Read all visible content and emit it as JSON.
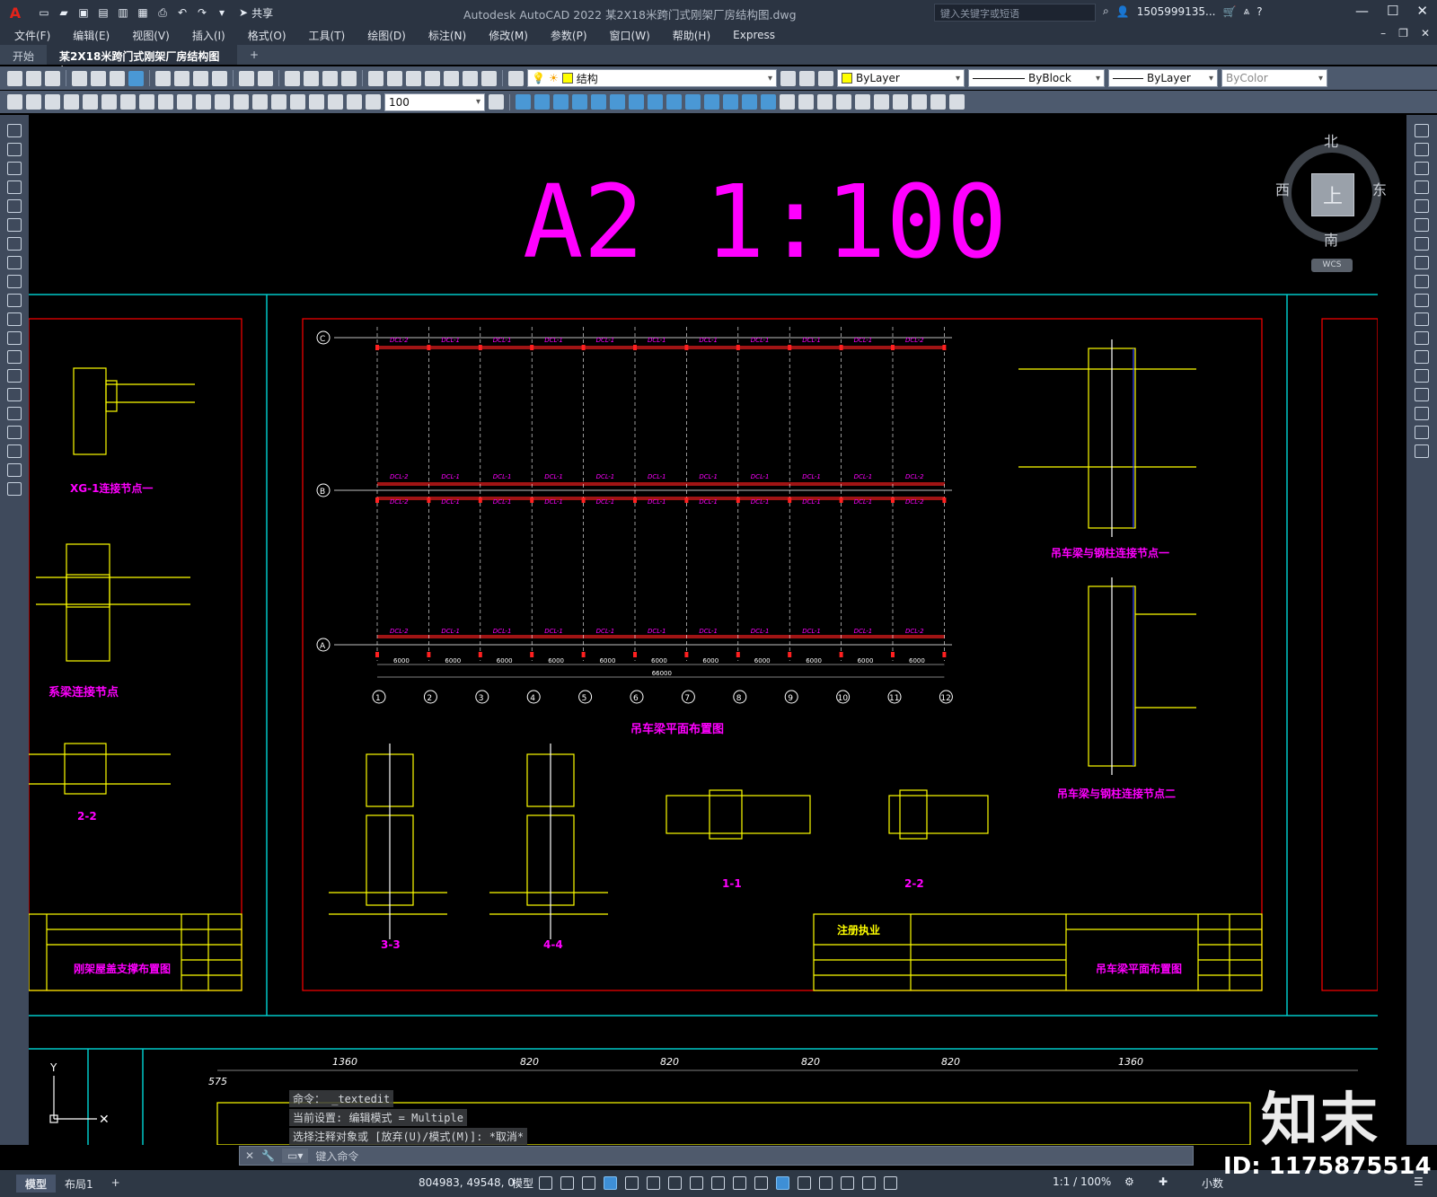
{
  "titlebar": {
    "logo": "A",
    "share": "共享",
    "app_title": "Autodesk AutoCAD 2022    某2X18米跨门式刚架厂房结构图.dwg",
    "search_placeholder": "键入关键字或短语",
    "user": "1505999135...",
    "min": "—",
    "max": "☐",
    "close": "✕"
  },
  "menubar": {
    "items": [
      "文件(F)",
      "编辑(E)",
      "视图(V)",
      "插入(I)",
      "格式(O)",
      "工具(T)",
      "绘图(D)",
      "标注(N)",
      "修改(M)",
      "参数(P)",
      "窗口(W)",
      "帮助(H)",
      "Express"
    ]
  },
  "tabs": {
    "start": "开始",
    "doc": "某2X18米跨门式刚架厂房结构图*",
    "close": "✕",
    "add": "+"
  },
  "toolbar1": {
    "layer": "结构",
    "color": "ByLayer",
    "linetype": "ByBlock",
    "lineweight": "ByLayer",
    "plotstyle": "ByColor"
  },
  "toolbar2": {
    "scale": "100"
  },
  "drawing": {
    "sheet_title": "A2 1:100",
    "main_caption": "吊车梁平面布置图",
    "detail1": "XG-1连接节点一",
    "detail2": "系梁连接节点",
    "section_22_left": "2-2",
    "detail_right1": "吊车梁与钢柱连接节点一",
    "detail_right2": "吊车梁与钢柱连接节点二",
    "sec_33": "3-3",
    "sec_44": "4-4",
    "sec_11": "1-1",
    "sec_22": "2-2",
    "tb_left_title": "刚架屋盖支撑布置图",
    "tb_right_title": "吊车梁平面布置图",
    "tb_reg": "注册执业",
    "axes": [
      "1",
      "2",
      "3",
      "4",
      "5",
      "6",
      "7",
      "8",
      "9",
      "10",
      "11",
      "12"
    ],
    "spans": [
      "6000",
      "6000",
      "6000",
      "6000",
      "6000",
      "6000",
      "6000",
      "6000",
      "6000",
      "6000",
      "6000"
    ],
    "total": "66000",
    "row_labels": [
      "C",
      "B",
      "A"
    ],
    "beams_top": [
      "DCL-2",
      "DCL-1",
      "DCL-1",
      "DCL-1",
      "DCL-1",
      "DCL-1",
      "DCL-1",
      "DCL-1",
      "DCL-1",
      "DCL-1",
      "DCL-2"
    ],
    "bottom_dims": [
      "1360",
      "820",
      "820",
      "820",
      "820",
      "1360"
    ],
    "dim_575": "575",
    "ucs_y": "Y"
  },
  "viewcube": {
    "north": "北",
    "south": "南",
    "east": "东",
    "west": "西",
    "top": "上",
    "wcs": "WCS"
  },
  "command": {
    "line1": "命令： _textedit",
    "line2": "当前设置: 编辑模式 = Multiple",
    "line3": "选择注释对象或 [放弃(U)/模式(M)]: *取消*",
    "input_placeholder": "键入命令"
  },
  "statusbar": {
    "tab_model": "模型",
    "tab_layout": "布局1",
    "add": "+",
    "coords": "804983, 49548, 0",
    "mode": "模型",
    "scale": "1:1 / 100%",
    "units": "小数"
  },
  "watermark": {
    "brand": "知末",
    "id": "ID: 1175875514"
  }
}
